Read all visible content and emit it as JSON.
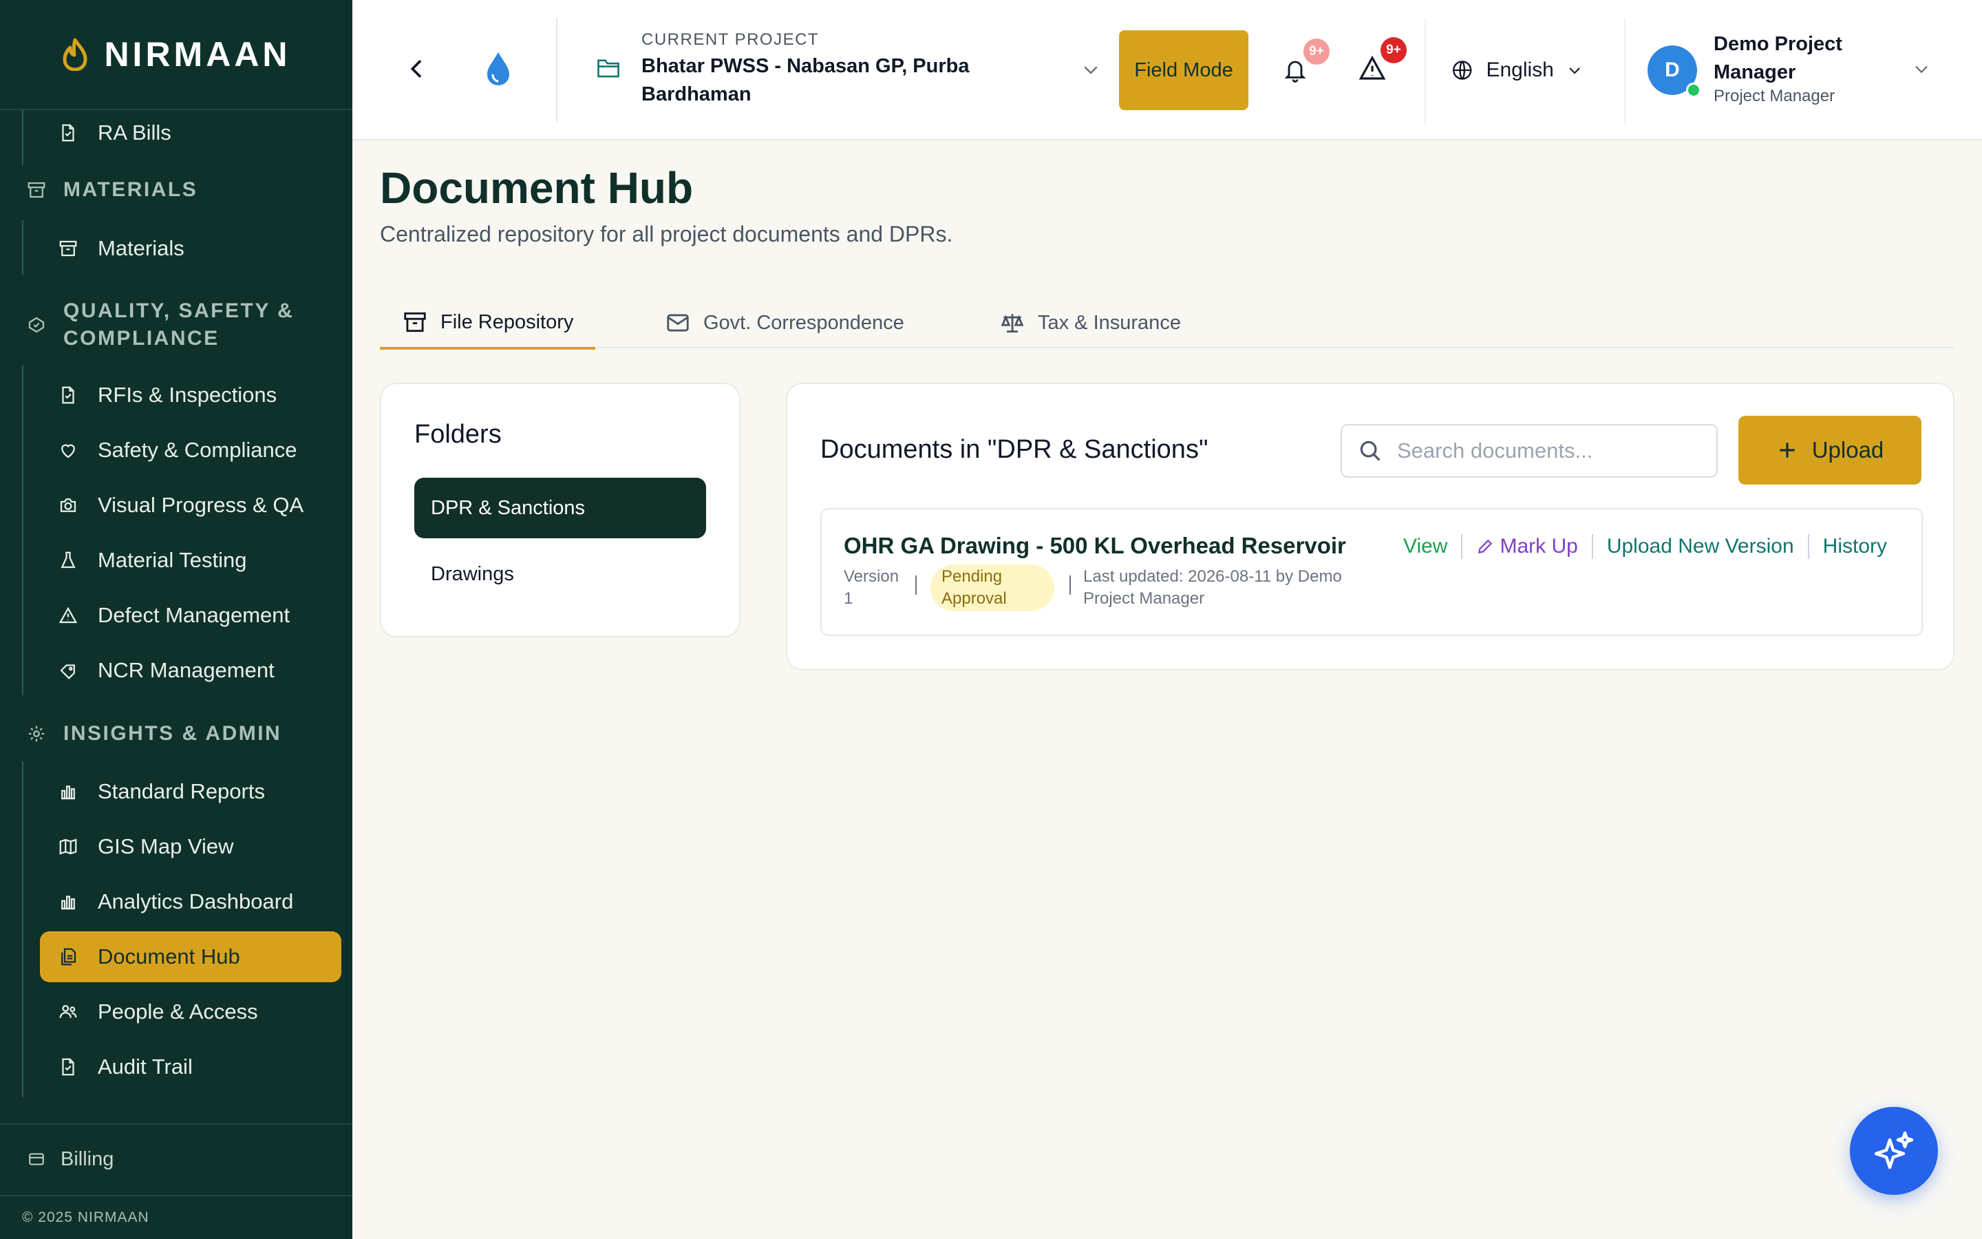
{
  "app": {
    "brand": "NIRMAAN"
  },
  "sidebar": {
    "top_items": [
      {
        "label": "RA Bills",
        "icon": "file-icon"
      }
    ],
    "sections": [
      {
        "label": "MATERIALS",
        "icon": "archive-icon",
        "items": [
          {
            "label": "Materials",
            "icon": "archive-icon"
          }
        ]
      },
      {
        "label": "QUALITY, SAFETY & COMPLIANCE",
        "icon": "badge-check-icon",
        "items": [
          {
            "label": "RFIs & Inspections",
            "icon": "file-icon"
          },
          {
            "label": "Safety & Compliance",
            "icon": "heart-icon"
          },
          {
            "label": "Visual Progress & QA",
            "icon": "camera-icon"
          },
          {
            "label": "Material Testing",
            "icon": "flask-icon"
          },
          {
            "label": "Defect Management",
            "icon": "warning-icon"
          },
          {
            "label": "NCR Management",
            "icon": "tag-icon"
          }
        ]
      },
      {
        "label": "INSIGHTS & ADMIN",
        "icon": "settings-icon",
        "items": [
          {
            "label": "Standard Reports",
            "icon": "bar-chart-icon"
          },
          {
            "label": "GIS Map View",
            "icon": "map-icon"
          },
          {
            "label": "Analytics Dashboard",
            "icon": "bar-chart-icon"
          },
          {
            "label": "Document Hub",
            "icon": "documents-icon",
            "active": true
          },
          {
            "label": "People & Access",
            "icon": "people-icon"
          },
          {
            "label": "Audit Trail",
            "icon": "file-icon"
          }
        ]
      }
    ],
    "billing": "Billing",
    "copyright": "© 2025 NIRMAAN"
  },
  "header": {
    "project_label": "CURRENT PROJECT",
    "project_name": "Bhatar PWSS - Nabasan GP, Purba Bardhaman",
    "field_mode": "Field Mode",
    "notifications_badge": "9+",
    "alerts_badge": "9+",
    "language": "English",
    "user_initial": "D",
    "user_name": "Demo Project Manager",
    "user_role": "Project Manager"
  },
  "page": {
    "title": "Document Hub",
    "subtitle": "Centralized repository for all project documents and DPRs.",
    "tabs": [
      {
        "label": "File Repository",
        "icon": "archive-icon",
        "active": true
      },
      {
        "label": "Govt. Correspondence",
        "icon": "mail-icon"
      },
      {
        "label": "Tax & Insurance",
        "icon": "scale-icon"
      }
    ]
  },
  "folders": {
    "heading": "Folders",
    "items": [
      {
        "label": "DPR & Sanctions",
        "active": true
      },
      {
        "label": "Drawings"
      }
    ]
  },
  "documents": {
    "heading": "Documents in \"DPR & Sanctions\"",
    "search_placeholder": "Search documents...",
    "upload_label": "Upload",
    "rows": [
      {
        "title": "OHR GA Drawing - 500 KL Overhead Reservoir",
        "version": "Version 1",
        "status": "Pending Approval",
        "updated": "Last updated: 2026-08-11 by Demo Project Manager",
        "actions": {
          "view": "View",
          "markup": "Mark Up",
          "new_version": "Upload New Version",
          "history": "History"
        }
      }
    ]
  },
  "colors": {
    "sidebar_bg": "#0f312b",
    "accent": "#d6a21e",
    "fab": "#2563eb"
  }
}
